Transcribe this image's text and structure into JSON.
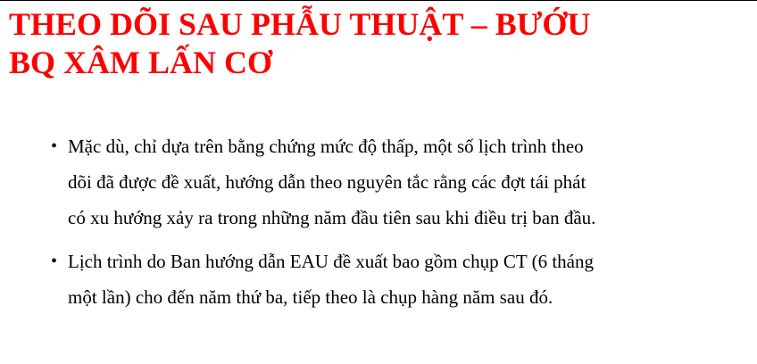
{
  "title": {
    "line1": "THEO DÕI SAU PHẪU THUẬT – BƯỚU",
    "line2": "BQ XÂM LẤN CƠ"
  },
  "bullets": [
    {
      "marker": "•",
      "lines": [
        "Mặc dù, chỉ dựa trên bằng chứng mức độ thấp, một số lịch trình theo",
        "dõi đã được đề xuất, hướng dẫn theo nguyên tắc rằng các đợt tái phát",
        "có xu hướng xảy ra trong những năm đầu tiên sau khi điều trị ban đầu."
      ]
    },
    {
      "marker": "•",
      "lines": [
        "Lịch trình do Ban hướng dẫn EAU đề xuất bao gồm chụp CT (6 tháng",
        "một lần) cho đến năm thứ ba, tiếp theo là chụp hàng năm sau đó."
      ]
    }
  ],
  "colors": {
    "title": "#ff0000",
    "body_text": "#000000",
    "background": "#ffffff",
    "top_rule": "#000000"
  }
}
